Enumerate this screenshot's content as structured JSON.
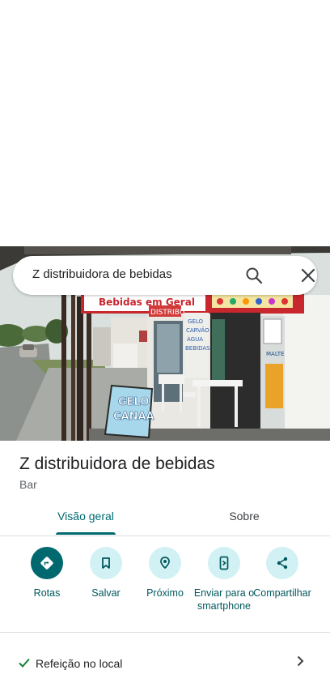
{
  "search": {
    "query": "Z distribuidora de bebidas"
  },
  "photo": {
    "banner_text": "Bebidas em Geral",
    "sign_left": "DISTRIBU",
    "wall_sign": [
      "GELO",
      "CARVÃO",
      "ÁGUA",
      "BEBIDAS"
    ],
    "placard": [
      "GELO",
      "CANAA"
    ],
    "poster": "MALTE"
  },
  "place": {
    "title": "Z distribuidora de bebidas",
    "category": "Bar"
  },
  "tabs": [
    {
      "label": "Visão geral",
      "active": true
    },
    {
      "label": "Sobre",
      "active": false
    }
  ],
  "actions": [
    {
      "label": "Rotas",
      "icon": "directions-icon"
    },
    {
      "label": "Salvar",
      "icon": "bookmark-icon"
    },
    {
      "label": "Próximo",
      "icon": "nearby-icon"
    },
    {
      "label": "Enviar para o smartphone",
      "icon": "send-to-phone-icon"
    },
    {
      "label": "Compartilhar",
      "icon": "share-icon"
    }
  ],
  "attributes": {
    "dine_in": "Refeição no local"
  },
  "colors": {
    "accent": "#00696f",
    "chip_bg": "#d2f1f4",
    "check": "#188038"
  }
}
